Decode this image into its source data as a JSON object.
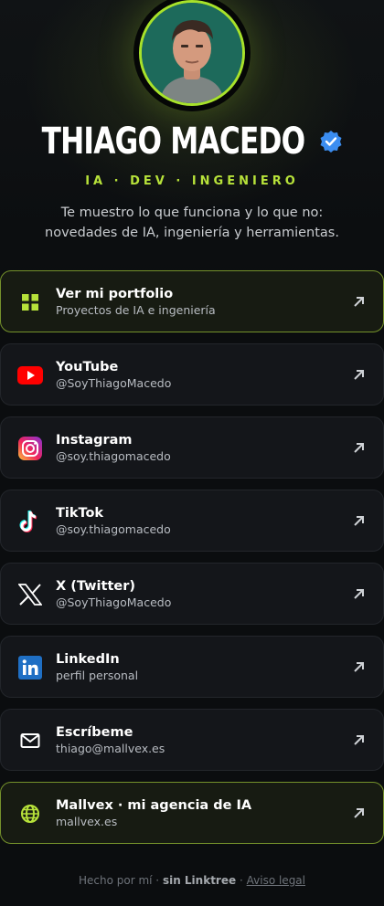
{
  "profile": {
    "name": "THIAGO MACEDO",
    "tagline": "IA · DEV · INGENIERO",
    "bio": "Te muestro lo que funciona y lo que no: novedades de IA, ingeniería y herramientas."
  },
  "links": [
    {
      "title": "Ver mi portfolio",
      "subtitle": "Proyectos de IA e ingeniería",
      "icon": "grid-icon"
    },
    {
      "title": "YouTube",
      "subtitle": "@SoyThiagoMacedo",
      "icon": "youtube-icon"
    },
    {
      "title": "Instagram",
      "subtitle": "@soy.thiagomacedo",
      "icon": "instagram-icon"
    },
    {
      "title": "TikTok",
      "subtitle": "@soy.thiagomacedo",
      "icon": "tiktok-icon"
    },
    {
      "title": "X (Twitter)",
      "subtitle": "@SoyThiagoMacedo",
      "icon": "x-icon"
    },
    {
      "title": "LinkedIn",
      "subtitle": "perfil personal",
      "icon": "linkedin-icon"
    },
    {
      "title": "Escríbeme",
      "subtitle": "thiago@mallvex.es",
      "icon": "mail-icon"
    },
    {
      "title": "Mallvex · mi agencia de IA",
      "subtitle": "mallvex.es",
      "icon": "globe-icon"
    }
  ],
  "footer": {
    "made_by": "Hecho por mí ·",
    "brand": "sin Linktree",
    "sep": "·",
    "legal": "Aviso legal"
  },
  "colors": {
    "accent": "#b7e23a",
    "background": "#0b0d0f",
    "card": "#14161a",
    "verified": "#3b8df0"
  }
}
